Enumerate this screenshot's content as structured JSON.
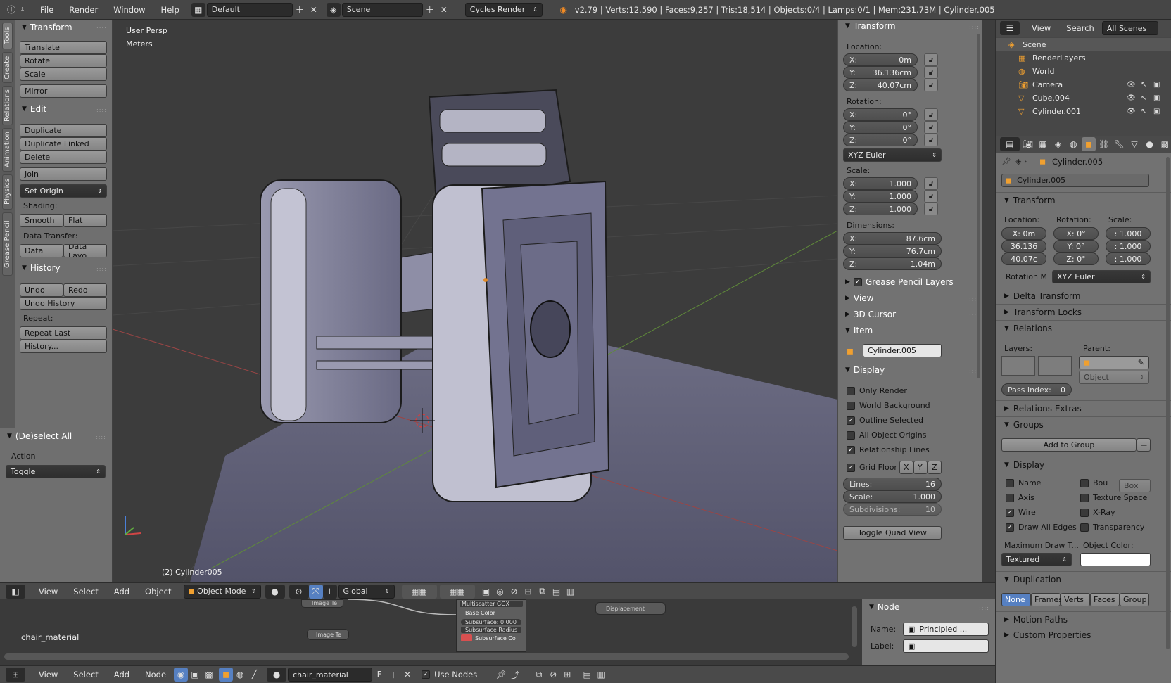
{
  "topbar": {
    "menus": [
      "File",
      "Render",
      "Window",
      "Help"
    ],
    "screen_layout": "Default",
    "scene": "Scene",
    "render_engine": "Cycles Render",
    "stats": "v2.79 | Verts:12,590 | Faces:9,257 | Tris:18,514 | Objects:0/4 | Lamps:0/1 | Mem:231.73M | Cylinder.005"
  },
  "vertical_tabs": [
    "Tools",
    "Create",
    "Relations",
    "Animation",
    "Physics",
    "Grease Pencil"
  ],
  "tool_shelf": {
    "transform": {
      "title": "Transform",
      "buttons": [
        "Translate",
        "Rotate",
        "Scale",
        "Mirror"
      ]
    },
    "edit": {
      "title": "Edit",
      "buttons": [
        "Duplicate",
        "Duplicate Linked",
        "Delete",
        "Join"
      ],
      "set_origin": "Set Origin",
      "shading_label": "Shading:",
      "smooth": "Smooth",
      "flat": "Flat",
      "data_transfer_label": "Data Transfer:",
      "data": "Data",
      "data_layout": "Data Layo"
    },
    "history": {
      "title": "History",
      "undo": "Undo",
      "redo": "Redo",
      "undo_history": "Undo History",
      "repeat_label": "Repeat:",
      "repeat_last": "Repeat Last",
      "history": "History..."
    },
    "operator": {
      "title": "(De)select All",
      "action_label": "Action",
      "action_value": "Toggle"
    }
  },
  "viewport": {
    "view_name": "User Persp",
    "units": "Meters",
    "object_label": "(2) Cylinder005"
  },
  "viewport_header": {
    "menus": [
      "View",
      "Select",
      "Add",
      "Object"
    ],
    "mode": "Object Mode",
    "orientation": "Global"
  },
  "n_panel": {
    "transform_title": "Transform",
    "location_label": "Location:",
    "location": [
      {
        "k": "X:",
        "v": "0m"
      },
      {
        "k": "Y:",
        "v": "36.136cm"
      },
      {
        "k": "Z:",
        "v": "40.07cm"
      }
    ],
    "rotation_label": "Rotation:",
    "rotation": [
      {
        "k": "X:",
        "v": "0°"
      },
      {
        "k": "Y:",
        "v": "0°"
      },
      {
        "k": "Z:",
        "v": "0°"
      }
    ],
    "rotation_mode": "XYZ Euler",
    "scale_label": "Scale:",
    "scale": [
      {
        "k": "X:",
        "v": "1.000"
      },
      {
        "k": "Y:",
        "v": "1.000"
      },
      {
        "k": "Z:",
        "v": "1.000"
      }
    ],
    "dimensions_label": "Dimensions:",
    "dimensions": [
      {
        "k": "X:",
        "v": "87.6cm"
      },
      {
        "k": "Y:",
        "v": "76.7cm"
      },
      {
        "k": "Z:",
        "v": "1.04m"
      }
    ],
    "grease_pencil": "Grease Pencil Layers",
    "view": "View",
    "cursor": "3D Cursor",
    "item_title": "Item",
    "item_name": "Cylinder.005",
    "display_title": "Display",
    "display_options": [
      {
        "label": "Only Render",
        "checked": false
      },
      {
        "label": "World Background",
        "checked": false
      },
      {
        "label": "Outline Selected",
        "checked": true
      },
      {
        "label": "All Object Origins",
        "checked": false
      },
      {
        "label": "Relationship Lines",
        "checked": true
      }
    ],
    "grid_floor": "Grid Floor",
    "grid_axes": [
      "X",
      "Y",
      "Z"
    ],
    "lines": {
      "k": "Lines:",
      "v": "16"
    },
    "grid_scale": {
      "k": "Scale:",
      "v": "1.000"
    },
    "subdivisions": {
      "k": "Subdivisions:",
      "v": "10"
    },
    "toggle_quad": "Toggle Quad View"
  },
  "outliner": {
    "header": {
      "view": "View",
      "search": "Search",
      "filter": "All Scenes"
    },
    "items": [
      {
        "label": "Scene",
        "icon": "scene-icon"
      },
      {
        "label": "RenderLayers",
        "icon": "renderlayers-icon"
      },
      {
        "label": "World",
        "icon": "world-icon"
      },
      {
        "label": "Camera",
        "icon": "camera-icon"
      },
      {
        "label": "Cube.004",
        "icon": "mesh-icon"
      },
      {
        "label": "Cylinder.001",
        "icon": "mesh-icon"
      }
    ]
  },
  "properties": {
    "breadcrumb": "Cylinder.005",
    "object_name": "Cylinder.005",
    "transform_title": "Transform",
    "location_label": "Location:",
    "rotation_label": "Rotation:",
    "scale_label": "Scale:",
    "loc": [
      "X: 0m",
      "36.136",
      "40.07c"
    ],
    "rot": [
      "X: 0°",
      "Y: 0°",
      "Z: 0°"
    ],
    "scl": [
      ": 1.000",
      ": 1.000",
      ": 1.000"
    ],
    "rotation_mode_label": "Rotation M",
    "rotation_mode": "XYZ Euler",
    "delta_transform": "Delta Transform",
    "transform_locks": "Transform Locks",
    "relations": "Relations",
    "layers_label": "Layers:",
    "parent_label": "Parent:",
    "parent_type": "Object",
    "pass_index": {
      "k": "Pass Index:",
      "v": "0"
    },
    "relations_extras": "Relations Extras",
    "groups": "Groups",
    "add_to_group": "Add to Group",
    "display": "Display",
    "display_left": [
      {
        "label": "Name",
        "checked": false
      },
      {
        "label": "Axis",
        "checked": false
      },
      {
        "label": "Wire",
        "checked": true
      },
      {
        "label": "Draw All Edges",
        "checked": true
      }
    ],
    "display_right": [
      {
        "label": "Bou",
        "checked": false
      },
      {
        "label": "Texture Space",
        "checked": false
      },
      {
        "label": "X-Ray",
        "checked": false
      },
      {
        "label": "Transparency",
        "checked": false
      }
    ],
    "bounds_type": "Box",
    "max_draw_label": "Maximum Draw T...",
    "object_color_label": "Object Color:",
    "max_draw": "Textured",
    "duplication": "Duplication",
    "dup_options": [
      "None",
      "Frames",
      "Verts",
      "Faces",
      "Group"
    ],
    "motion_paths": "Motion Paths",
    "custom_props": "Custom Properties"
  },
  "node_editor": {
    "material": "chair_material",
    "nodes": {
      "multiscatter": "Multiscatter GGX",
      "base_color": "Base Color",
      "subsurface": "Subsurface: 0.000",
      "subsurface_radius": "Subsurface Radius",
      "subsurface_color": "Subsurface Co",
      "image_texture": "Image Te",
      "image_texture_top": "Image Te",
      "displacement": "Displacement"
    },
    "header": {
      "menus": [
        "View",
        "Select",
        "Add",
        "Node"
      ],
      "material_field": "chair_material",
      "fake_user": "F",
      "use_nodes": "Use Nodes"
    }
  },
  "node_panel": {
    "title": "Node",
    "name_label": "Name:",
    "name_value": "Principled ...",
    "label_label": "Label:"
  }
}
